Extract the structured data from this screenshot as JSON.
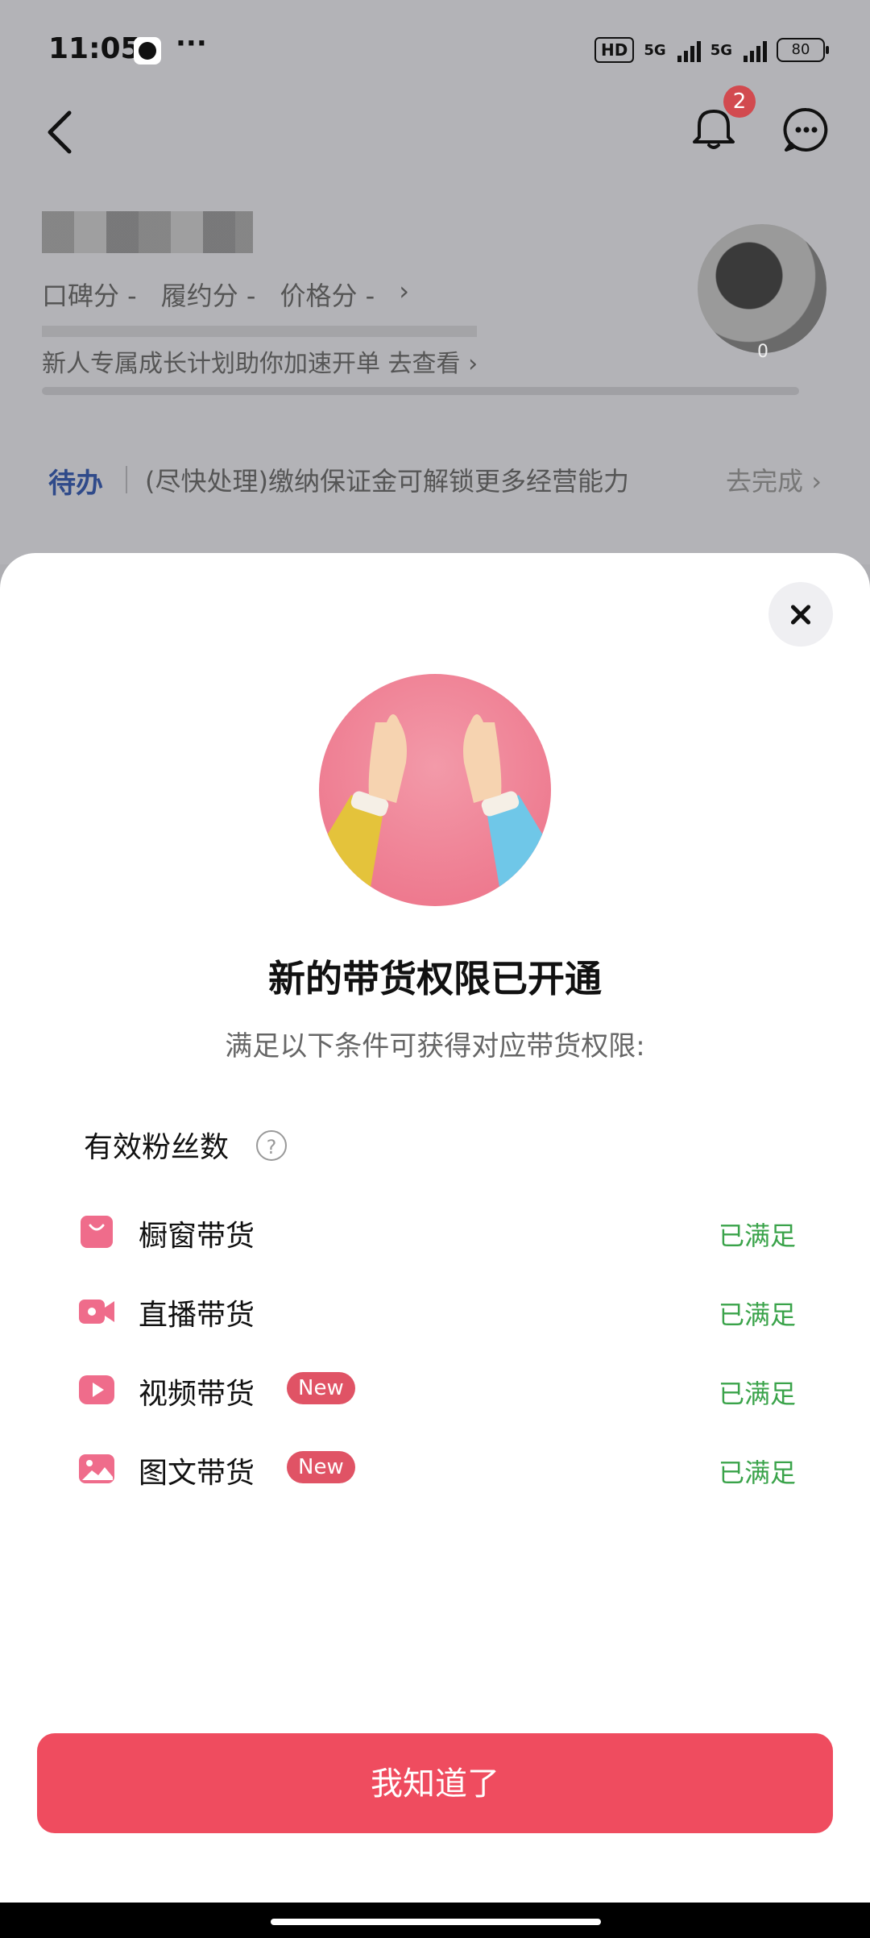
{
  "status_bar": {
    "time": "11:05",
    "more": "···",
    "hd": "HD",
    "network1": "5G",
    "network2": "5G",
    "battery": "80"
  },
  "header": {
    "notification_count": "2"
  },
  "profile": {
    "scores": [
      "口碑分 -",
      "履约分 -",
      "价格分 -",
      "›"
    ],
    "promo": "新人专属成长计划助你加速开单 去查看 ›",
    "avatar_badge": "0"
  },
  "todo": {
    "label": "待办",
    "text": "(尽快处理)缴纳保证金可解锁更多经营能力",
    "action": "去完成 ›"
  },
  "sheet": {
    "title": "新的带货权限已开通",
    "subtitle": "满足以下条件可获得对应带货权限:",
    "section_title": "有效粉丝数",
    "help": "?",
    "permissions": [
      {
        "label": "橱窗带货",
        "status": "已满足",
        "badge": ""
      },
      {
        "label": "直播带货",
        "status": "已满足",
        "badge": ""
      },
      {
        "label": "视频带货",
        "status": "已满足",
        "badge": "New"
      },
      {
        "label": "图文带货",
        "status": "已满足",
        "badge": "New"
      }
    ],
    "button": "我知道了"
  },
  "colors": {
    "accent": "#ef4c5f",
    "success": "#3aa34a",
    "badge": "#e05365",
    "todo_label": "#2f4a8a"
  }
}
